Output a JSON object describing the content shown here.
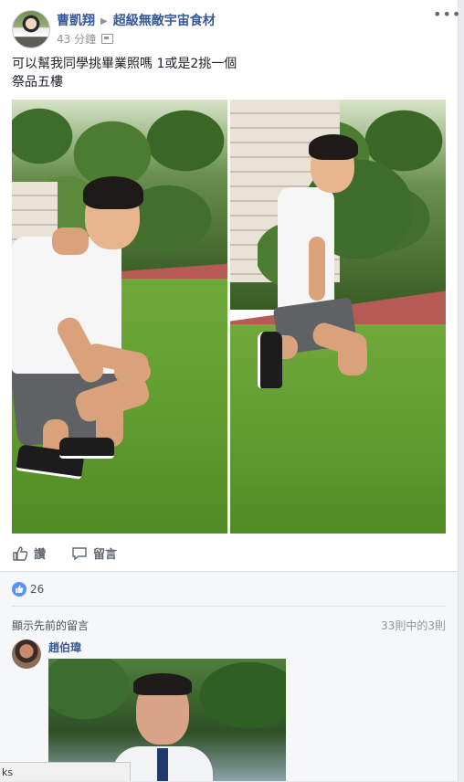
{
  "post": {
    "author": "曹凱翔",
    "group": "超級無敵宇宙食材",
    "time": "43 分鐘",
    "more_icon": "more-options-icon",
    "text_line1": "可以幫我同學挑畢業照嗎 1或是2挑一個",
    "text_line2": "祭品五樓"
  },
  "actions": {
    "like_label": "讚",
    "comment_label": "留言"
  },
  "reactions": {
    "count": "26"
  },
  "comments": {
    "view_previous": "顯示先前的留言",
    "count_text": "33則中的3則",
    "first_commenter": "趙伯瑋"
  },
  "status_tip": "ks",
  "colors": {
    "link": "#365899",
    "like_blue": "#5890ff",
    "background": "#e9ebee"
  }
}
